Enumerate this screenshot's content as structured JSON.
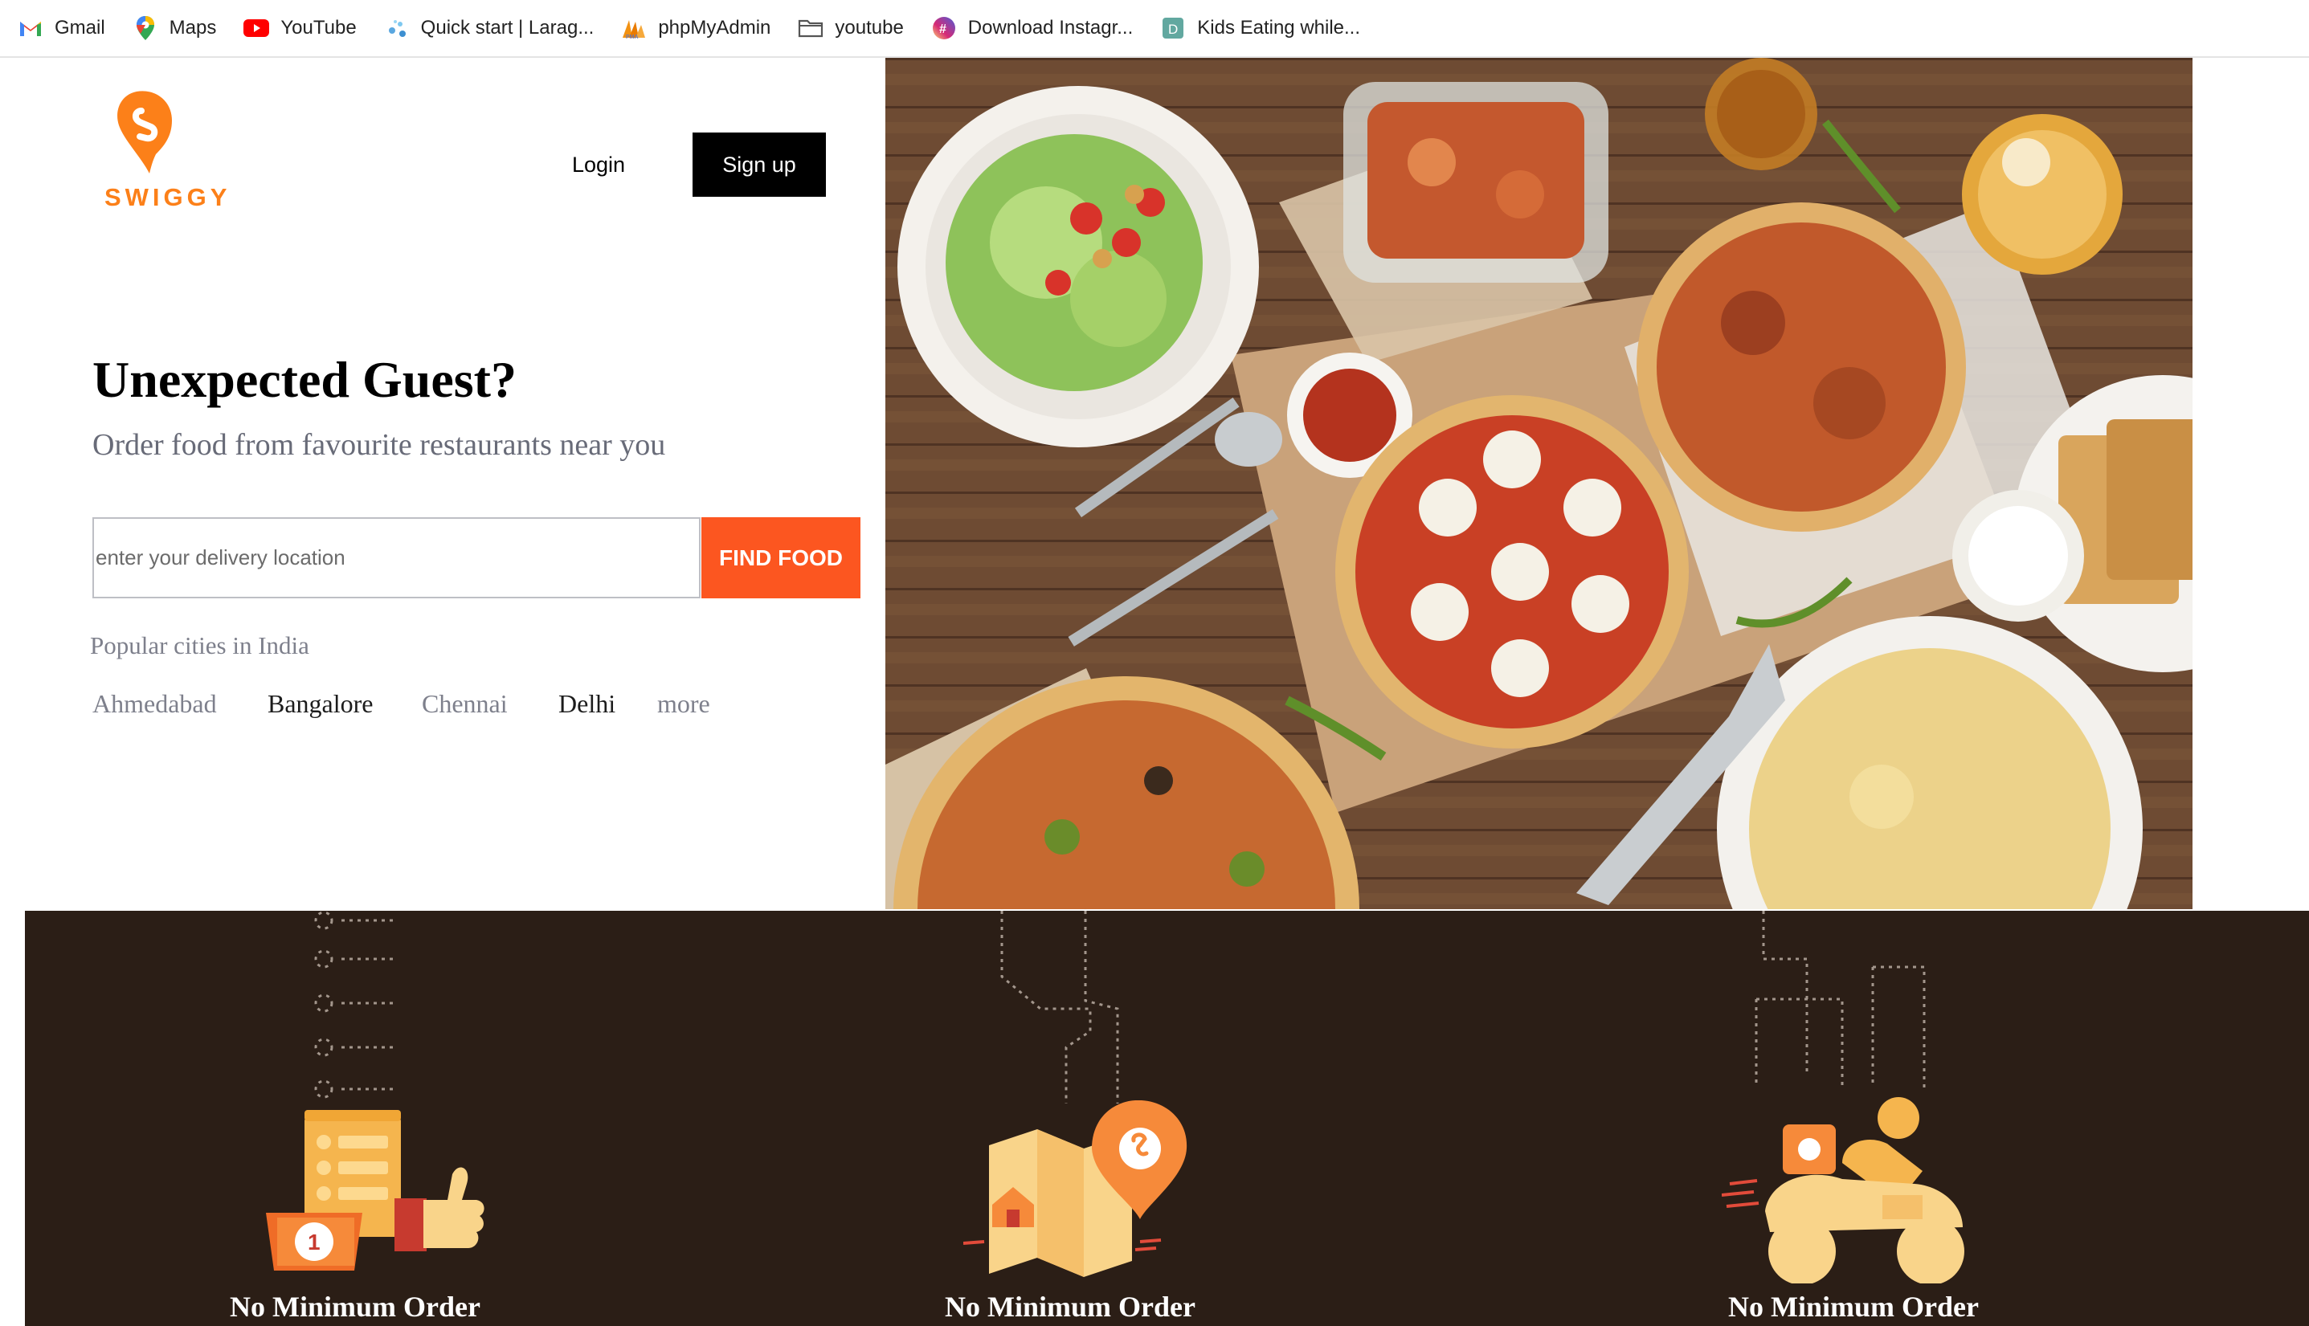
{
  "bookmarks": [
    {
      "label": "Gmail",
      "icon": "gmail-icon"
    },
    {
      "label": "Maps",
      "icon": "maps-icon"
    },
    {
      "label": "YouTube",
      "icon": "youtube-icon"
    },
    {
      "label": "Quick start | Larag...",
      "icon": "laragon-icon"
    },
    {
      "label": "phpMyAdmin",
      "icon": "phpmyadmin-icon"
    },
    {
      "label": "youtube",
      "icon": "folder-icon"
    },
    {
      "label": "Download Instagr...",
      "icon": "instagram-download-icon"
    },
    {
      "label": "Kids Eating while...",
      "icon": "d-site-icon"
    }
  ],
  "header": {
    "logo_text": "SWIGGY",
    "login_label": "Login",
    "signup_label": "Sign up",
    "brand_color": "#fc8019"
  },
  "hero": {
    "title": "Unexpected Guest?",
    "subtitle": "Order food from favourite restaurants near you",
    "search_placeholder": "enter your delivery location",
    "find_label": "FIND FOOD",
    "popular_label": "Popular cities in India",
    "cities": [
      "Ahmedabad",
      "Bangalore",
      "Chennai",
      "Delhi",
      "more"
    ],
    "find_color": "#fc5620"
  },
  "features": [
    {
      "title": "No Minimum Order",
      "icon": "order-thumbs-up-icon"
    },
    {
      "title": "No Minimum Order",
      "icon": "map-location-pin-icon"
    },
    {
      "title": "No Minimum Order",
      "icon": "delivery-scooter-icon"
    }
  ],
  "features_bg_color": "#2b1e16"
}
